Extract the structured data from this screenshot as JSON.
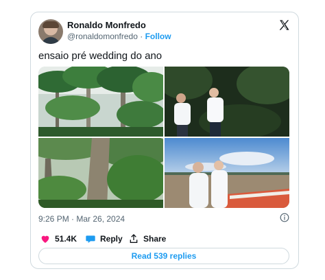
{
  "tweet": {
    "author": {
      "name": "Ronaldo Monfredo",
      "handle": "@ronaldomonfredo",
      "separator": " · ",
      "follow_label": "Follow"
    },
    "text": "ensaio pré wedding do ano",
    "timestamp": "9:26 PM · Mar 26, 2024",
    "likes": "51.4K",
    "reply_label": "Reply",
    "share_label": "Share",
    "replies_button": "Read 539 replies"
  },
  "colors": {
    "accent": "#1d9bf0",
    "like": "#f91880",
    "text": "#0f1419",
    "muted": "#536471",
    "border": "#cfd9de"
  },
  "icons": [
    "x-logo-icon",
    "info-icon",
    "heart-icon",
    "reply-bubble-icon",
    "share-icon"
  ]
}
